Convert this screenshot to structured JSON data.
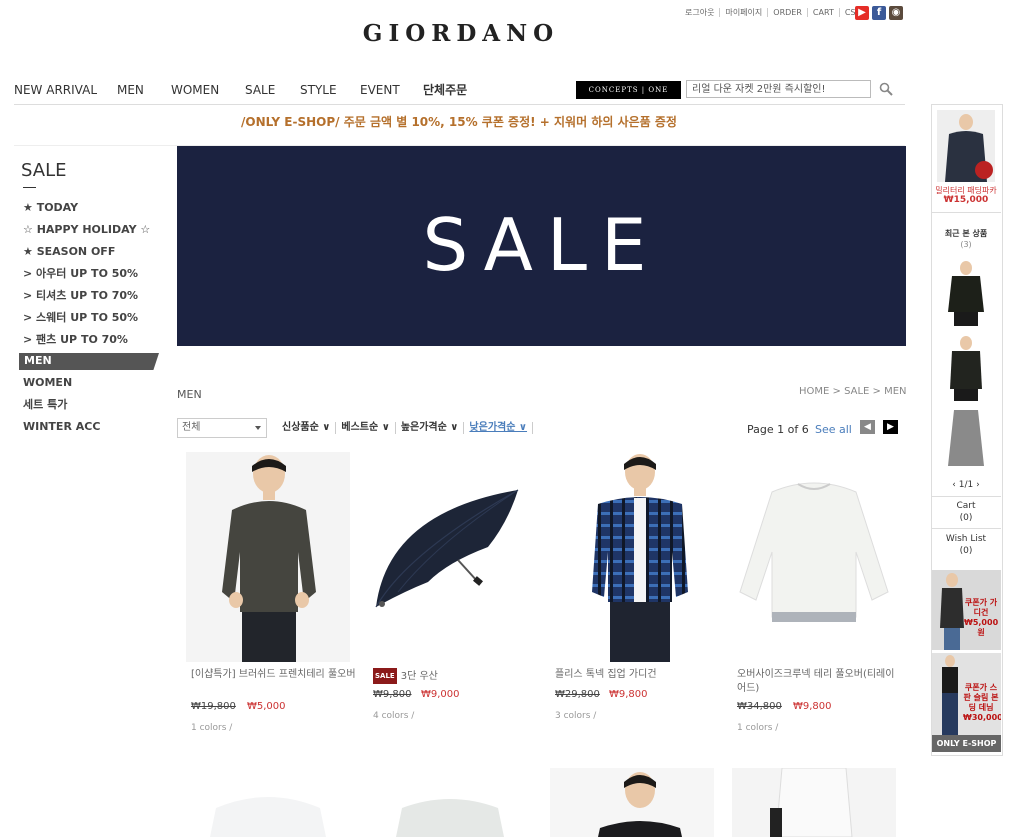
{
  "util_links": [
    "로그아웃",
    "마이페이지",
    "ORDER",
    "CART",
    "CS"
  ],
  "social": [
    {
      "name": "youtube-icon",
      "color": "#e52d27",
      "glyph": "▶"
    },
    {
      "name": "facebook-icon",
      "color": "#3b5998",
      "glyph": "f"
    },
    {
      "name": "instagram-icon",
      "color": "#5b4a3c",
      "glyph": "◉"
    }
  ],
  "logo": "GIORDANO",
  "nav": [
    "NEW ARRIVAL",
    "MEN",
    "WOMEN",
    "SALE",
    "STYLE",
    "EVENT",
    "단체주문"
  ],
  "concepts_label": "CONCEPTS | ONE",
  "search_value": "리얼 다운 자켓 2만원 즉시할인!",
  "promo": "/ONLY E-SHOP/  주문 금액 별 10%, 15% 쿠폰 증정! + 지워머 하의 사은품 증정",
  "sidebar": {
    "title": "SALE",
    "items": [
      "★ TODAY",
      "☆ HAPPY HOLIDAY ☆",
      "★ SEASON OFF",
      "> 아우터 UP TO 50%",
      "> 티셔츠 UP TO 70%",
      "> 스웨터 UP TO 50%",
      "> 팬츠 UP TO 70%"
    ],
    "active": "MEN",
    "items2": [
      "WOMEN",
      "세트 특가",
      "WINTER ACC"
    ]
  },
  "banner_text": "SALE",
  "category_title": "MEN",
  "breadcrumb": "HOME > SALE > MEN",
  "filter_select": "전체",
  "sorts": [
    "신상품순 ∨",
    "베스트순 ∨",
    "높은가격순 ∨",
    "낮은가격순 ∨"
  ],
  "page_info": "Page 1 of 6",
  "see_all": "See all",
  "products": [
    {
      "name": "[이샵특가] 브러쉬드 프렌치테리 풀오버",
      "old": "₩19,800",
      "new": "₩5,000",
      "colors": "1 colors /",
      "sale_badge": false
    },
    {
      "name": "3단 우산",
      "old": "₩9,800",
      "new": "₩9,000",
      "colors": "4 colors /",
      "sale_badge": true,
      "badge": "SALE"
    },
    {
      "name": "플리스 톡넥 집업 가디건",
      "old": "₩29,800",
      "new": "₩9,800",
      "colors": "3 colors /",
      "sale_badge": false
    },
    {
      "name": "오버사이즈크루넥 테리 풀오버(티레이어드)",
      "old": "₩34,800",
      "new": "₩9,800",
      "colors": "1 colors /",
      "sale_badge": false
    }
  ],
  "quick": {
    "top_name": "밀리터리 패딩파카",
    "top_price": "₩15,000",
    "recent_label": "최근 본 상품",
    "recent_count": "(3)",
    "pager": "‹ 1/1 ›",
    "cart": "Cart",
    "cart_count": "(0)",
    "wish": "Wish List",
    "wish_count": "(0)",
    "ad1": "쿠폰가 가디건 ₩5,000원",
    "ad2": "쿠폰가 스판 슬림 본딩 데님 ₩30,000",
    "ad_footer": "ONLY E-SHOP"
  },
  "colors": {
    "banner": "#1b2240",
    "sale_red": "#c33",
    "link_blue": "#4a7dbb",
    "promo_gold": "#b5702c"
  }
}
